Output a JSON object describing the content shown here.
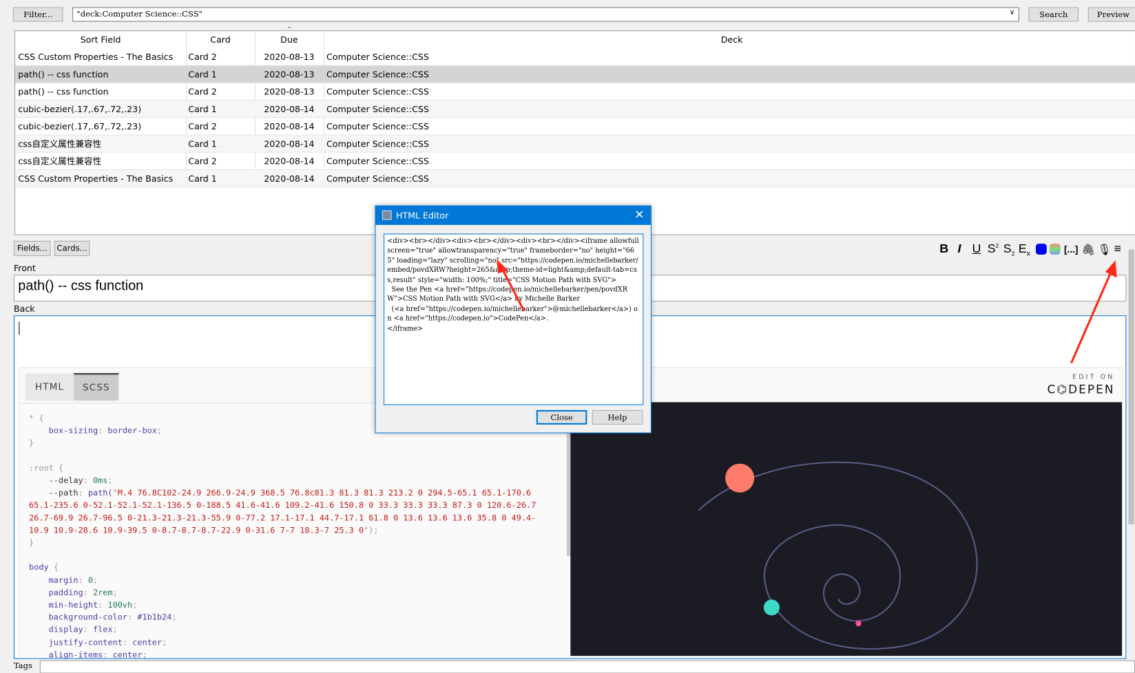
{
  "toolbar": {
    "filter_label": "Filter...",
    "search_query": "\"deck:Computer Science::CSS\"",
    "search_label": "Search",
    "preview_label": "Preview"
  },
  "table": {
    "columns": [
      "Sort Field",
      "Card",
      "Due",
      "Deck"
    ],
    "sort_indicator": "^",
    "rows": [
      {
        "sort_field": "CSS Custom Properties - The Basics",
        "card": "Card 2",
        "due": "2020-08-13",
        "deck": "Computer Science::CSS"
      },
      {
        "sort_field": "path() -- css function",
        "card": "Card 1",
        "due": "2020-08-13",
        "deck": "Computer Science::CSS",
        "selected": true
      },
      {
        "sort_field": "path() -- css function",
        "card": "Card 2",
        "due": "2020-08-13",
        "deck": "Computer Science::CSS"
      },
      {
        "sort_field": "cubic-bezier(.17,.67,.72,.23)",
        "card": "Card 1",
        "due": "2020-08-14",
        "deck": "Computer Science::CSS"
      },
      {
        "sort_field": "cubic-bezier(.17,.67,.72,.23)",
        "card": "Card 2",
        "due": "2020-08-14",
        "deck": "Computer Science::CSS"
      },
      {
        "sort_field": "css自定义属性兼容性",
        "card": "Card 1",
        "due": "2020-08-14",
        "deck": "Computer Science::CSS"
      },
      {
        "sort_field": "css自定义属性兼容性",
        "card": "Card 2",
        "due": "2020-08-14",
        "deck": "Computer Science::CSS"
      },
      {
        "sort_field": "CSS Custom Properties - The Basics",
        "card": "Card 1",
        "due": "2020-08-14",
        "deck": "Computer Science::CSS"
      }
    ]
  },
  "editor": {
    "fields_label": "Fields...",
    "cards_label": "Cards...",
    "format_icons": [
      "bold-icon",
      "italic-icon",
      "underline-icon",
      "superscript-icon",
      "subscript-icon",
      "clear-format-icon",
      "text-color-icon",
      "highlight-color-icon",
      "cloze-icon",
      "attach-icon",
      "record-audio-icon",
      "more-icon"
    ],
    "format_glyphs": {
      "bold": "B",
      "italic": "I",
      "underline": "U",
      "cloze": "[...]",
      "more": "≡"
    },
    "text_color": "#0000ff",
    "front_label": "Front",
    "front_value": "path() -- css function",
    "back_label": "Back",
    "tags_label": "Tags"
  },
  "codepen": {
    "tabs": [
      "HTML",
      "SCSS"
    ],
    "active_tab": "SCSS",
    "edit_on": "EDIT ON",
    "brand": "C⌬DEPEN",
    "code_lines": [
      [
        [
          "* {",
          "c-gray"
        ]
      ],
      [
        [
          "    box-sizing",
          "c-prop"
        ],
        [
          ": ",
          "c-gray"
        ],
        [
          "border-box",
          "c-prop"
        ],
        [
          ";",
          "c-gray"
        ]
      ],
      [
        [
          "}",
          "c-gray"
        ]
      ],
      [
        [
          "",
          "c-plain"
        ]
      ],
      [
        [
          ":root {",
          "c-gray"
        ]
      ],
      [
        [
          "    --delay",
          "c-plain"
        ],
        [
          ": ",
          "c-gray"
        ],
        [
          "0ms",
          "c-val"
        ],
        [
          ";",
          "c-gray"
        ]
      ],
      [
        [
          "    --path",
          "c-plain"
        ],
        [
          ": ",
          "c-gray"
        ],
        [
          "path(",
          "c-prop"
        ],
        [
          "'M.4 76.8C102-24.9 266.9-24.9 368.5 76.8c81.3 81.3 81.3 213.2 0 294.5-65.1 65.1-170.6",
          "c-str"
        ]
      ],
      [
        [
          "65.1-235.6 0-52.1-52.1-52.1-136.5 0-188.5 41.6-41.6 109.2-41.6 150.8 0 33.3 33.3 33.3 87.3 0 120.6-26.7",
          "c-str"
        ]
      ],
      [
        [
          "26.7-69.9 26.7-96.5 0-21.3-21.3-21.3-55.9 0-77.2 17.1-17.1 44.7-17.1 61.8 0 13.6 13.6 13.6 35.8 0 49.4-",
          "c-str"
        ]
      ],
      [
        [
          "10.9 10.9-28.6 10.9-39.5 0-8.7-8.7-8.7-22.9 0-31.6 7-7 18.3-7 25.3 0'",
          "c-str"
        ],
        [
          ");",
          "c-gray"
        ]
      ],
      [
        [
          "}",
          "c-gray"
        ]
      ],
      [
        [
          "",
          "c-plain"
        ]
      ],
      [
        [
          "body",
          "c-prop"
        ],
        [
          " {",
          "c-gray"
        ]
      ],
      [
        [
          "    margin",
          "c-prop"
        ],
        [
          ": ",
          "c-gray"
        ],
        [
          "0",
          "c-val"
        ],
        [
          ";",
          "c-gray"
        ]
      ],
      [
        [
          "    padding",
          "c-prop"
        ],
        [
          ": ",
          "c-gray"
        ],
        [
          "2rem",
          "c-val"
        ],
        [
          ";",
          "c-gray"
        ]
      ],
      [
        [
          "    min-height",
          "c-prop"
        ],
        [
          ": ",
          "c-gray"
        ],
        [
          "100vh",
          "c-val"
        ],
        [
          ";",
          "c-gray"
        ]
      ],
      [
        [
          "    background-color",
          "c-prop"
        ],
        [
          ": ",
          "c-gray"
        ],
        [
          "#1b1b24",
          "c-prop"
        ],
        [
          ";",
          "c-gray"
        ]
      ],
      [
        [
          "    display",
          "c-prop"
        ],
        [
          ": ",
          "c-gray"
        ],
        [
          "flex",
          "c-prop"
        ],
        [
          ";",
          "c-gray"
        ]
      ],
      [
        [
          "    justify-content",
          "c-prop"
        ],
        [
          ": ",
          "c-gray"
        ],
        [
          "center",
          "c-prop"
        ],
        [
          ";",
          "c-gray"
        ]
      ],
      [
        [
          "    align-items",
          "c-prop"
        ],
        [
          ": ",
          "c-gray"
        ],
        [
          "center",
          "c-prop"
        ],
        [
          ";",
          "c-gray"
        ]
      ]
    ],
    "preview_bg": "#1b1b24",
    "dot_colors": [
      "#ff7b6b",
      "#3dd9c8",
      "#ff4fa0"
    ]
  },
  "dialog": {
    "title": "HTML Editor",
    "content": "<div><br></div><div><br></div><div><br></div><iframe allowfullscreen=\"true\" allowtransparency=\"true\" frameborder=\"no\" height=\"665\" loading=\"lazy\" scrolling=\"no\" src=\"https://codepen.io/michellebarker/embed/povdXRW?height=265&amp;theme-id=light&amp;default-tab=css,result\" style=\"width: 100%;\" title=\"CSS Motion Path with SVG\">\n  See the Pen <a href=\"https://codepen.io/michellebarker/pen/povdXRW\">CSS Motion Path with SVG</a> by Michelle Barker\n  (<a href=\"https://codepen.io/michellebarker\">@michellebarker</a>) on <a href=\"https://codepen.io\">CodePen</a>.\n</iframe>",
    "close_label": "Close",
    "help_label": "Help"
  },
  "annotation_color": "#ff2a1a",
  "accent": "#0078d7"
}
